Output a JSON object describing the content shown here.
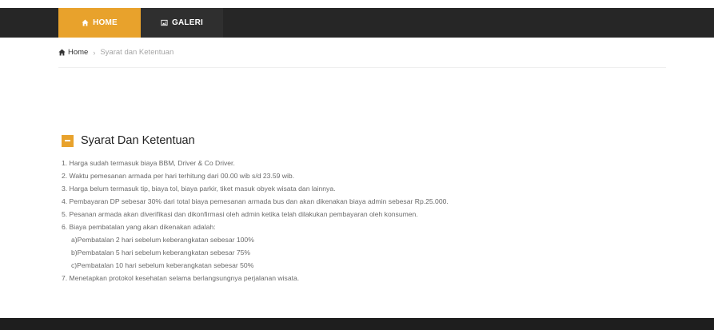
{
  "nav": {
    "items": [
      {
        "label": "HOME",
        "icon": "home-icon",
        "active": true
      },
      {
        "label": "GALERI",
        "icon": "gallery-icon",
        "active": false
      }
    ]
  },
  "breadcrumb": {
    "home": "Home",
    "separator": "›",
    "current": "Syarat dan Ketentuan"
  },
  "section": {
    "title": "Syarat Dan Ketentuan",
    "terms": [
      "1. Harga sudah termasuk biaya BBM, Driver & Co Driver.",
      "2. Waktu pemesanan armada per hari terhitung dari 00.00 wib s/d 23.59 wib.",
      "3. Harga belum termasuk tip, biaya tol, biaya parkir, tiket masuk obyek wisata dan lainnya.",
      "4. Pembayaran DP sebesar 30% dari total biaya pemesanan armada bus dan akan dikenakan biaya admin sebesar Rp.25.000.",
      "5. Pesanan armada akan diverifikasi dan dikonfirmasi oleh admin ketika telah dilakukan pembayaran oleh konsumen.",
      "6. Biaya pembatalan yang akan dikenakan adalah:",
      "a)Pembatalan 2 hari sebelum keberangkatan sebesar 100%",
      "b)Pembatalan 5 hari sebelum keberangkatan sebesar 75%",
      "c)Pembatalan 10 hari sebelum keberangkatan sebesar 50%",
      "7. Menetapkan protokol kesehatan selama berlangsungnya perjalanan wisata."
    ]
  },
  "colors": {
    "accent": "#e8a22c",
    "navbar": "#262626",
    "footer": "#1e1e1e"
  }
}
